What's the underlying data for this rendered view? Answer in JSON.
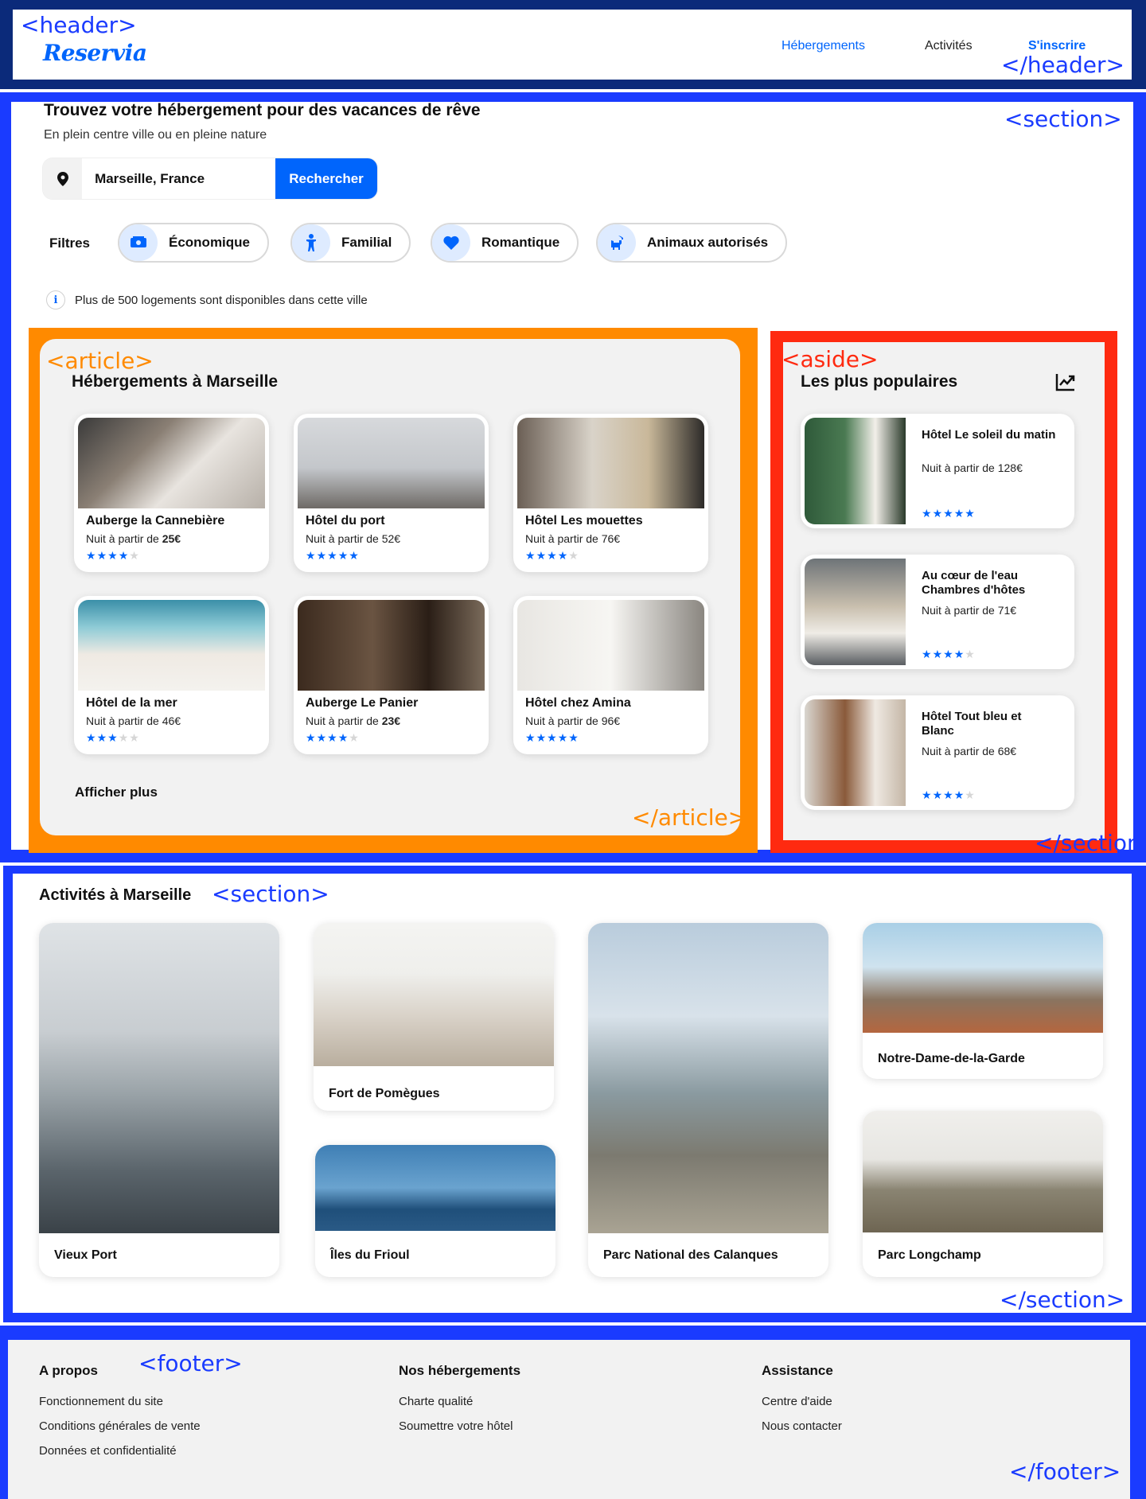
{
  "annotations": {
    "header_open": "<header>",
    "header_close": "</header>",
    "section_open_1": "<section>",
    "section_close_1": "</section>",
    "article_open": "<article>",
    "article_close": "</article>",
    "aside_open": "<aside>",
    "section_open_2": "<section>",
    "section_close_2": "</section>",
    "footer_open": "<footer>",
    "footer_close": "</footer>"
  },
  "header": {
    "logo": "Reservia",
    "nav": [
      "Hébergements",
      "Activités",
      "S'inscrire"
    ]
  },
  "hero": {
    "title": "Trouvez votre hébergement pour des vacances de rêve",
    "subtitle": "En plein centre ville ou en pleine nature",
    "search_value": "Marseille, France",
    "search_button": "Rechercher",
    "filters_label": "Filtres",
    "filters": [
      "Économique",
      "Familial",
      "Romantique",
      "Animaux autorisés"
    ],
    "info": "Plus de 500 logements sont disponibles dans cette ville"
  },
  "accommodations": {
    "title": "Hébergements à Marseille",
    "price_prefix": "Nuit à partir de ",
    "items": [
      {
        "name": "Auberge la Cannebière",
        "price": "25€",
        "price_bold": true,
        "rating": 4
      },
      {
        "name": "Hôtel du port",
        "price": "52€",
        "price_bold": false,
        "rating": 5
      },
      {
        "name": "Hôtel Les mouettes",
        "price": "76€",
        "price_bold": false,
        "rating": 4
      },
      {
        "name": "Hôtel de la mer",
        "price": "46€",
        "price_bold": false,
        "rating": 3
      },
      {
        "name": "Auberge Le Panier",
        "price": "23€",
        "price_bold": true,
        "rating": 4
      },
      {
        "name": "Hôtel chez Amina",
        "price": "96€",
        "price_bold": false,
        "rating": 5
      }
    ],
    "more": "Afficher plus"
  },
  "popular": {
    "title": "Les plus populaires",
    "price_prefix": "Nuit à partir de ",
    "items": [
      {
        "name": "Hôtel Le soleil du matin",
        "price": "128€",
        "rating": 5
      },
      {
        "name": "Au cœur de l'eau Chambres d'hôtes",
        "price": "71€",
        "rating": 4
      },
      {
        "name": "Hôtel Tout bleu et Blanc",
        "price": "68€",
        "rating": 4
      }
    ]
  },
  "activities": {
    "title": "Activités à Marseille",
    "items": [
      "Vieux Port",
      "Fort de Pomègues",
      "Îles du Frioul",
      "Parc National des Calanques",
      "Notre-Dame-de-la-Garde",
      "Parc Longchamp"
    ]
  },
  "footer": {
    "columns": [
      {
        "title": "A propos",
        "links": [
          "Fonctionnement du site",
          "Conditions générales de vente",
          "Données et confidentialité"
        ]
      },
      {
        "title": "Nos hébergements",
        "links": [
          "Charte qualité",
          "Soumettre votre hôtel"
        ]
      },
      {
        "title": "Assistance",
        "links": [
          "Centre d'aide",
          "Nous contacter"
        ]
      }
    ]
  },
  "colors": {
    "brand": "#0065fc",
    "brand_light": "#deebff",
    "background_light": "#f2f2f2",
    "annotation_blue": "#1a3bff",
    "annotation_orange": "#ff8a00",
    "annotation_red": "#ff2a10",
    "header_frame": "#0b2a7a"
  }
}
